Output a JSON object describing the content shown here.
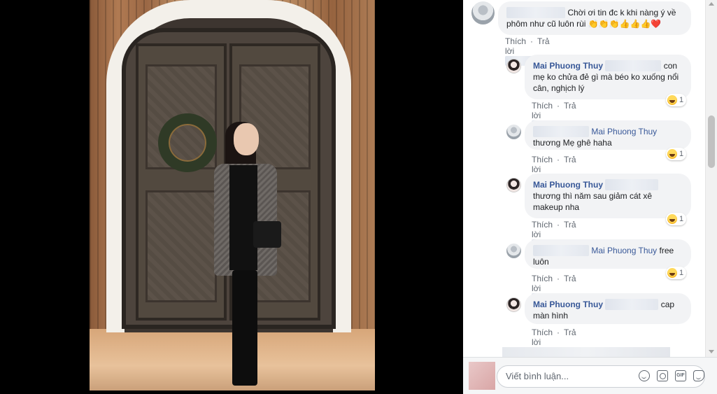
{
  "comments": [
    {
      "author": "",
      "text": "Chời ơi tin đc k khi nàng ý về phôm như cũ luôn rùi",
      "emoji": "👏👏👏👍👍👍❤️",
      "actions": {
        "like": "Thích",
        "reply": "Trả lời"
      }
    },
    {
      "author": "Mai Phuong Thuy",
      "text_end": "con",
      "text": "mẹ ko chửa đẻ gì mà béo ko xuống nổi cân, nghịch lý",
      "reaction_count": "1",
      "actions": {
        "like": "Thích",
        "reply": "Trả lời"
      }
    },
    {
      "mention": "Mai Phuong Thuy",
      "text": "thương Mẹ ghê haha",
      "reaction_count": "1",
      "actions": {
        "like": "Thích",
        "reply": "Trả lời"
      }
    },
    {
      "author": "Mai Phuong Thuy",
      "text": "thương thì năm sau giảm cát xê makeup nha",
      "reaction_count": "1",
      "actions": {
        "like": "Thích",
        "reply": "Trả lời"
      }
    },
    {
      "mention": "Mai Phuong Thuy",
      "text_end": "free",
      "text": "luôn",
      "reaction_count": "1",
      "actions": {
        "like": "Thích",
        "reply": "Trả lời"
      }
    },
    {
      "author": "Mai Phuong Thuy",
      "text_end": "cap",
      "text": "màn hình",
      "actions": {
        "like": "Thích",
        "reply": "Trả lời"
      }
    }
  ],
  "composer": {
    "placeholder": "Viết bình luận...",
    "gif_label": "GIF"
  },
  "icons": [
    "smile-icon",
    "camera-icon",
    "gif-icon",
    "sticker-icon",
    "haha-reaction-icon"
  ]
}
